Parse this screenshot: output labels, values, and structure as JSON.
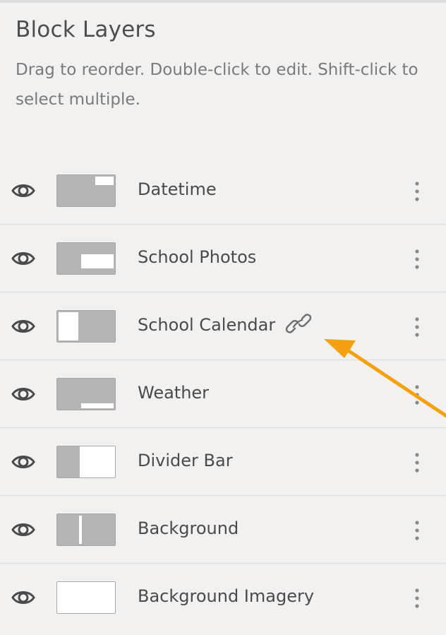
{
  "panel": {
    "title": "Block Layers",
    "description": "Drag to reorder. Double-click to edit. Shift-click to select multiple."
  },
  "layers": [
    {
      "name": "Datetime",
      "visible": true,
      "linked": false
    },
    {
      "name": "School Photos",
      "visible": true,
      "linked": false
    },
    {
      "name": "School Calendar",
      "visible": true,
      "linked": true
    },
    {
      "name": "Weather",
      "visible": true,
      "linked": false
    },
    {
      "name": "Divider Bar",
      "visible": true,
      "linked": false
    },
    {
      "name": "Background",
      "visible": true,
      "linked": false
    },
    {
      "name": "Background Imagery",
      "visible": true,
      "linked": false
    }
  ],
  "icons": {
    "visibility": "eye-icon",
    "menu": "kebab-menu-icon",
    "link": "link-icon"
  },
  "colors": {
    "background": "#f2f1f0",
    "divider": "#dcdcdc",
    "thumbnail_gray": "#b4b4b4",
    "annotation_arrow": "#f5a00f"
  }
}
